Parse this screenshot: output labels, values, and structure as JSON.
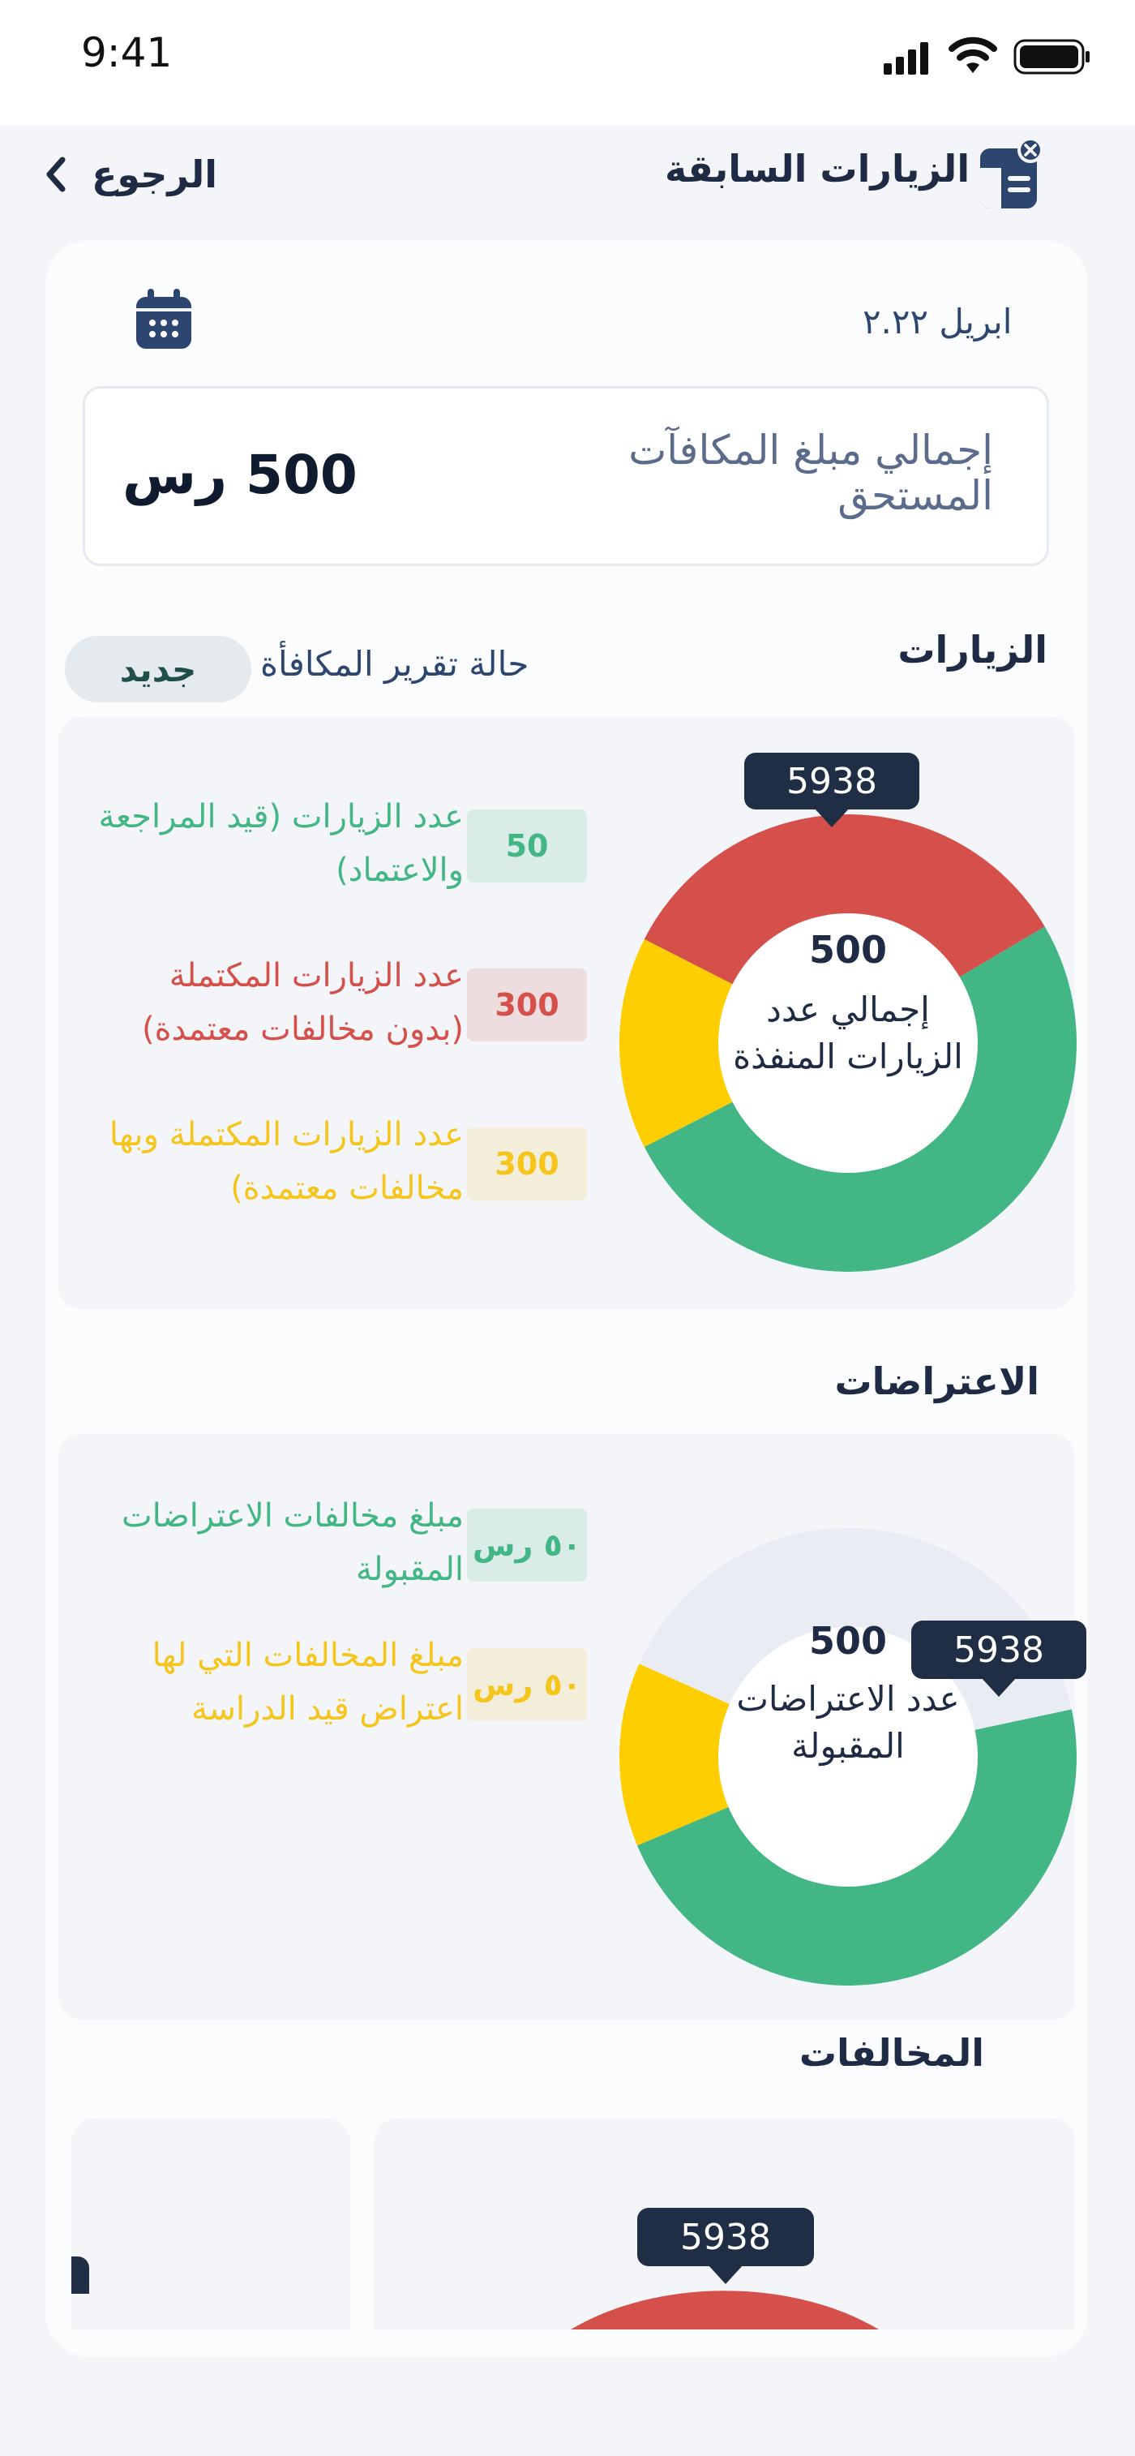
{
  "status_bar": {
    "time": "9:41"
  },
  "header": {
    "title": "الزيارات السابقة",
    "back_label": "الرجوع"
  },
  "period": {
    "label": "ابريل ٢.٢٢"
  },
  "rewards_total": {
    "label": "إجمالي مبلغ المكافآت المستحق",
    "value": "500 رس"
  },
  "visits": {
    "title": "الزيارات",
    "report_status_label": "حالة تقرير المكافأة",
    "report_status_value": "جديد",
    "legend": [
      {
        "label": "عدد الزيارات (قيد المراجعة والاعتماد)",
        "value": "50",
        "color": "#42b685"
      },
      {
        "label": "عدد الزيارات المكتملة (بدون مخالفات معتمدة)",
        "value": "300",
        "color": "#d5504a"
      },
      {
        "label": "عدد الزيارات المكتملة وبها مخالفات معتمدة)",
        "value": "300",
        "color": "#f5c51b"
      }
    ],
    "center_value": "500",
    "center_label": "إجمالي عدد الزيارات المنفذة",
    "tooltip": "5938"
  },
  "objections": {
    "title": "الاعتراضات",
    "legend": [
      {
        "label": "مبلغ مخالفات الاعتراضات المقبولة",
        "value": "٥٠ رس",
        "color": "#42b685"
      },
      {
        "label": "مبلغ المخالفات التي لها اعتراض قيد الدراسة",
        "value": "٥٠ رس",
        "color": "#f5c51b"
      }
    ],
    "center_value": "500",
    "center_label": "عدد الاعتراضات المقبولة",
    "tooltip": "5938"
  },
  "violations": {
    "title": "المخالفات",
    "tooltip": "5938"
  },
  "colors": {
    "green": "#42b685",
    "red": "#d5504a",
    "yellow": "#ffce00",
    "empty": "#e9edf3",
    "dark": "#1f2a44"
  },
  "chart_data": [
    {
      "type": "pie",
      "series": [
        {
          "name": "عدد الزيارات (قيد المراجعة والاعتماد)",
          "color": "#d5504a",
          "value": 34
        },
        {
          "name": "عدد الزيارات المكتملة (بدون مخالفات معتمدة)",
          "color": "#42b685",
          "value": 51
        },
        {
          "name": "عدد الزيارات المكتملة وبها مخالفات معتمدة)",
          "color": "#ffce00",
          "value": 15
        }
      ]
    },
    {
      "type": "pie",
      "series": [
        {
          "name": "مبلغ مخالفات الاعتراضات المقبولة",
          "color": "#42b685",
          "value": 47
        },
        {
          "name": "مبلغ المخالفات التي لها اعتراض قيد الدراسة",
          "color": "#ffce00",
          "value": 13
        },
        {
          "name": "",
          "color": "#e9edf3",
          "value": 40
        }
      ]
    }
  ]
}
